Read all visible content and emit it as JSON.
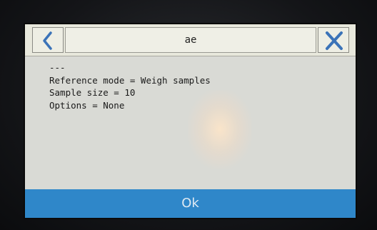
{
  "header": {
    "title": "ae",
    "back_icon": "chevron-left-icon",
    "close_icon": "close-icon"
  },
  "content": {
    "lines": [
      "---",
      "Reference mode = Weigh samples",
      "Sample size = 10",
      "Options = None"
    ]
  },
  "footer": {
    "ok_label": "Ok"
  },
  "colors": {
    "accent": "#2f87c9",
    "icon": "#3b73b8"
  }
}
